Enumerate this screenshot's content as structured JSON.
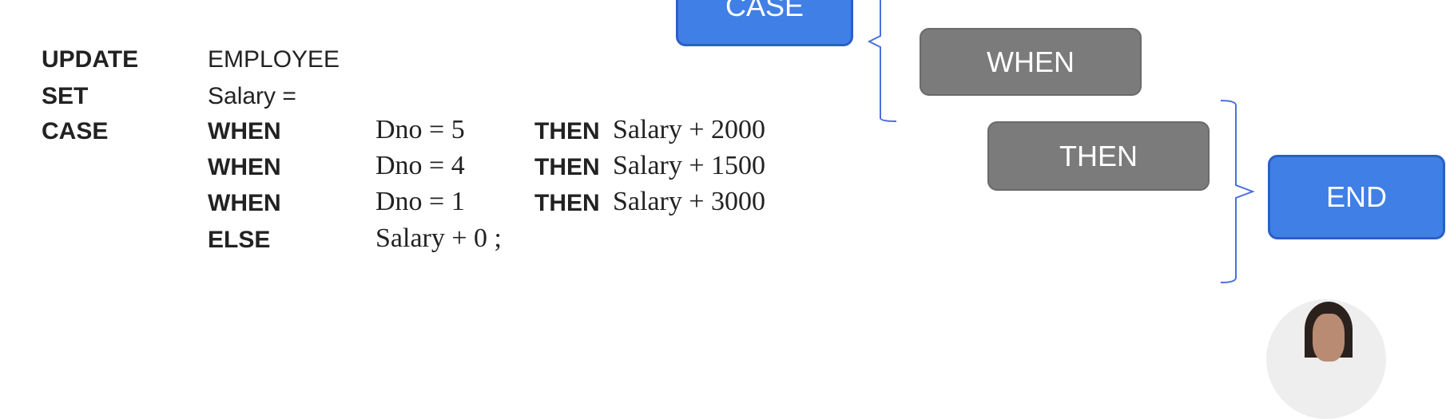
{
  "sql": {
    "rows": [
      {
        "c1": "UPDATE",
        "c2": "EMPLOYEE"
      },
      {
        "c1": "SET",
        "c2": "Salary  ="
      },
      {
        "c1": "CASE",
        "c2": "WHEN",
        "cond": "Dno = 5",
        "then": "THEN",
        "expr": "Salary + 2000"
      },
      {
        "c1": "",
        "c2": "WHEN",
        "cond": "Dno = 4",
        "then": "THEN",
        "expr": "Salary + 1500"
      },
      {
        "c1": "",
        "c2": "WHEN",
        "cond": "Dno = 1",
        "then": "THEN",
        "expr": "Salary + 3000"
      },
      {
        "c1": "",
        "c2": "ELSE",
        "cond": "Salary + 0 ;"
      }
    ]
  },
  "diagram": {
    "case": "CASE",
    "when": "WHEN",
    "then": "THEN",
    "end": "END",
    "colors": {
      "blue": "#3f7fe6",
      "gray": "#7b7b7b",
      "bracket": "#4a6fe0"
    }
  }
}
